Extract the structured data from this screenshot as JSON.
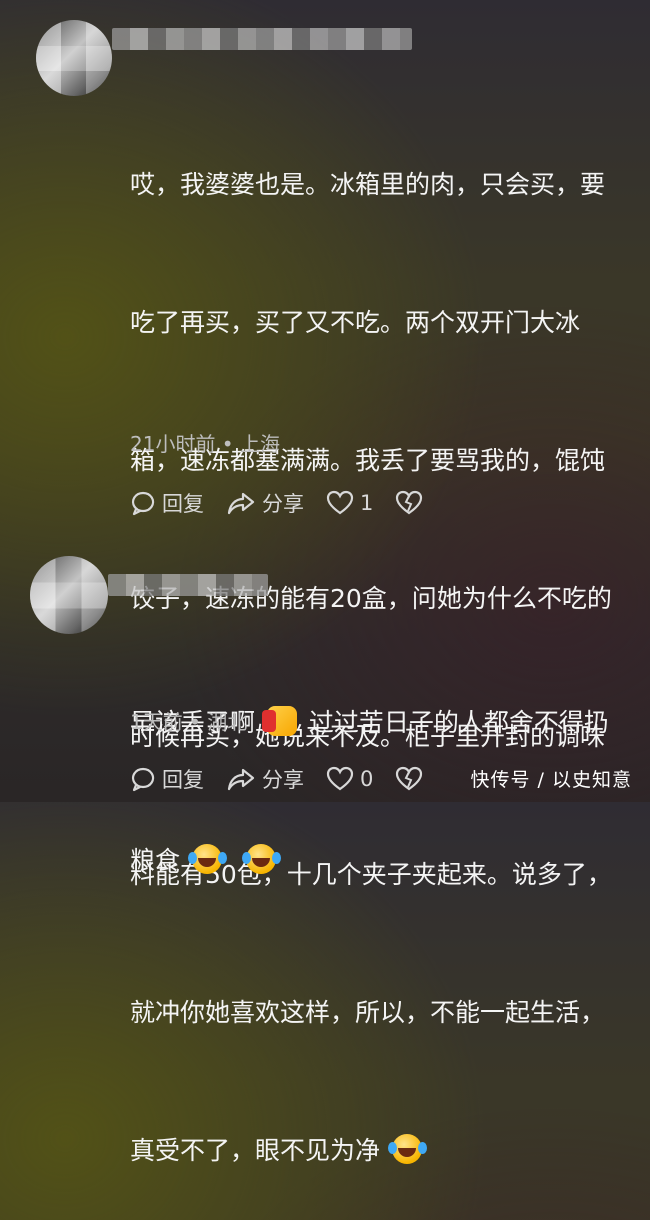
{
  "comments": [
    {
      "text_lines": [
        "哎，我婆婆也是。冰箱里的肉，只会买，要",
        "吃了再买，买了又不吃。两个双开门大冰",
        "箱，速冻都塞满满。我丢了要骂我的，馄饨",
        "饺子，速冻的能有20盒，问她为什么不吃的",
        "时候再买，她说来不及。柜子里开封的调味",
        "料能有50包，十几个夹子夹起来。说多了，",
        "就冲你她喜欢这样，所以，不能一起生活，",
        "真受不了，眼不见为净"
      ],
      "emoji_after_text": [
        "laughing-crying"
      ],
      "meta": "21小时前 • 上海",
      "reply_label": "回复",
      "share_label": "分享",
      "like_count": "1"
    },
    {
      "text_lines": [
        "早该丢了啊",
        "过过苦日子的人都舍不得扔",
        "粮食"
      ],
      "meta": "1天前 • 湖北",
      "reply_label": "回复",
      "share_label": "分享",
      "like_count": "0"
    }
  ],
  "watermark": "快传号 / 以史知意",
  "colors": {
    "text": "#f4f4f4",
    "meta": "#bdbdbd",
    "emoji_yellow": "#f7b500"
  }
}
